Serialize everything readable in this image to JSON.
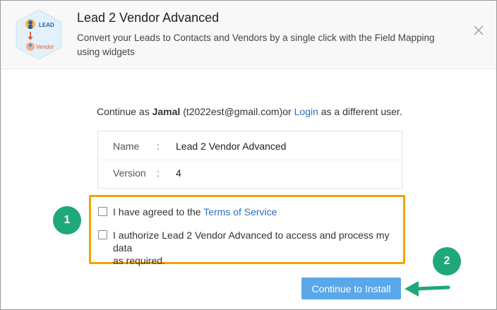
{
  "header": {
    "title": "Lead 2 Vendor Advanced",
    "description": "Convert your Leads to Contacts and Vendors by a single click with the Field Mapping using widgets",
    "logo": {
      "top_label": "LEAD",
      "bottom_label": "Vendor"
    }
  },
  "auth": {
    "prefix": "Continue as ",
    "user_name": "Jamal",
    "email": " (t2022est@gmail.com)or ",
    "login_link": "Login",
    "suffix": " as a different user."
  },
  "details": [
    {
      "key": "Name",
      "sep": ":",
      "value": "Lead 2 Vendor Advanced"
    },
    {
      "key": "Version",
      "sep": ":",
      "value": "4"
    }
  ],
  "consent": {
    "terms_prefix": "I have agreed to the ",
    "terms_link": "Terms of Service",
    "authorize_line1": "I authorize Lead 2 Vendor Advanced to access and process my data",
    "authorize_line2": "as required."
  },
  "annotations": {
    "step1": "1",
    "step2": "2"
  },
  "actions": {
    "install_label": "Continue to Install"
  },
  "colors": {
    "accent": "#5aa7ea",
    "link": "#2f6fbf",
    "highlight_border": "#f0a500",
    "annotation_green": "#1fa87a"
  }
}
